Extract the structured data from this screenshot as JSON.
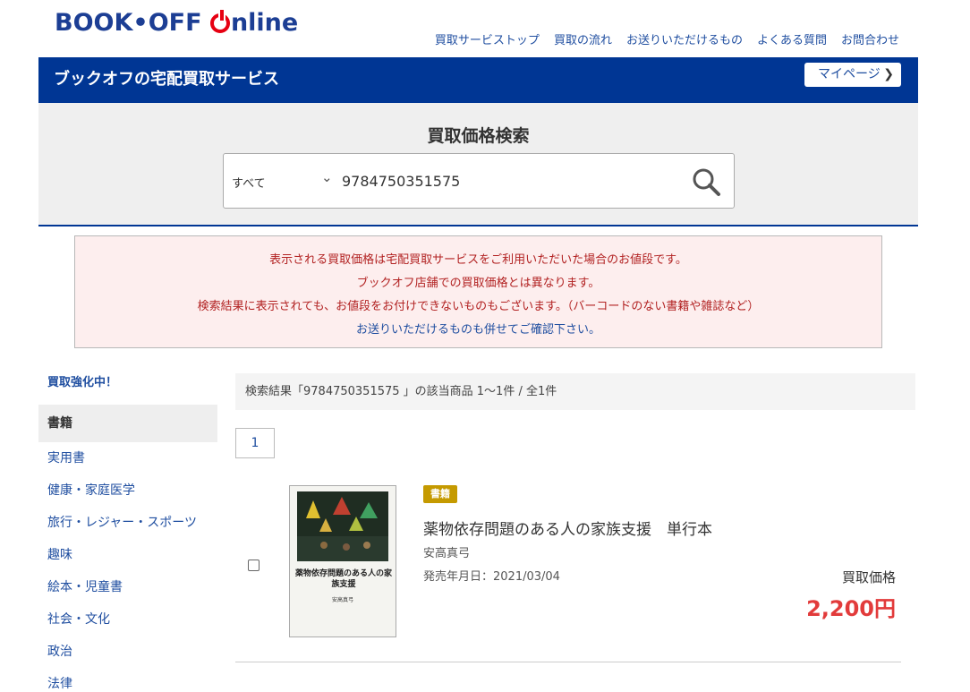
{
  "header": {
    "logo_text": "BOOK•OFF Online",
    "nav": [
      "買取サービストップ",
      "買取の流れ",
      "お送りいただけるもの",
      "よくある質問",
      "お問合わせ"
    ]
  },
  "bluebar": {
    "title": "ブックオフの宅配買取サービス",
    "mypage": "マイページ"
  },
  "search": {
    "title": "買取価格検索",
    "category": "すべて",
    "query": "9784750351575"
  },
  "notice": {
    "line1": "表示される買取価格は宅配買取サービスをご利用いただいた場合のお値段です。",
    "line2": "ブックオフ店舗での買取価格とは異なります。",
    "line3": "検索結果に表示されても、お値段をお付けできないものもございます。（バーコードのない書籍や雑誌など）",
    "line4": "お送りいただけるものも併せてご確認下さい。"
  },
  "sidebar": {
    "hot": "買取強化中！",
    "category": "書籍",
    "items": [
      "実用書",
      "健康・家庭医学",
      "旅行・レジャー・スポーツ",
      "趣味",
      "絵本・児童書",
      "社会・文化",
      "政治",
      "法律"
    ]
  },
  "results": {
    "summary": "検索結果「9784750351575 」の該当商品 1～1件 / 全1件",
    "page": "1"
  },
  "product": {
    "badge": "書籍",
    "title": "薬物依存問題のある人の家族支援　単行本",
    "author": "安高真弓",
    "release": "発売年月日：2021/03/04",
    "price_label": "買取価格",
    "price": "2,200円",
    "cover_title": "薬物依存問題のある人の家族支援",
    "cover_author": "安高真弓"
  },
  "colors": {
    "brand_blue": "#003694",
    "link_blue": "#1f4ea0",
    "price_red": "#e23b3b",
    "badge_gold": "#c59a00"
  }
}
